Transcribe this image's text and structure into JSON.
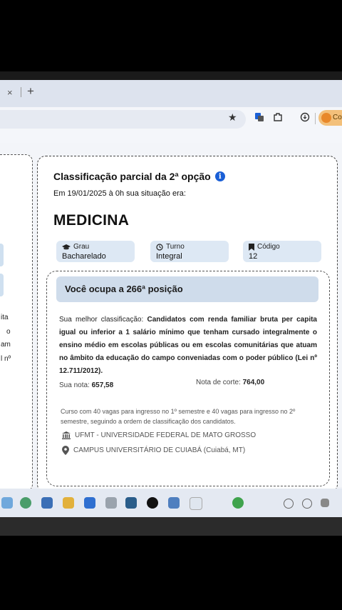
{
  "browser": {
    "tab_close_glyph": "×",
    "new_tab_glyph": "+",
    "profile_label": "Co"
  },
  "left_card": {
    "lines": [
      "ita",
      "o",
      "am",
      "l nº"
    ]
  },
  "result": {
    "title": "Classificação parcial da 2ª opção",
    "date_line": "Em 19/01/2025 à 0h sua situação era:",
    "course": "MEDICINA",
    "grau_label": "Grau",
    "grau_value": "Bacharelado",
    "turno_label": "Turno",
    "turno_value": "Integral",
    "codigo_label": "Código",
    "codigo_value": "12",
    "position_text": "Você ocupa a 266ª posição",
    "best_label": "Sua melhor classificação:",
    "best_text": "Candidatos com renda familiar bruta per capita igual ou inferior a 1 salário mínimo que tenham cursado integralmente o ensino médio em escolas públicas ou em escolas comunitárias que atuam no âmbito da educação do campo conveniadas com o poder público (Lei nº 12.711/2012).",
    "grade_label": "Sua nota:",
    "grade_value": "657,58",
    "cut_label": "Nota de corte:",
    "cut_value": "764,00",
    "vagas_text": "Curso com 40 vagas para ingresso no 1º semestre e 40 vagas para ingresso no 2º semestre, seguindo a ordem de classificação dos candidatos.",
    "university": "UFMT - UNIVERSIDADE FEDERAL DE MATO GROSSO",
    "campus": "CAMPUS UNIVERSITÁRIO DE CUIABÁ (Cuiabá, MT)"
  },
  "colors": {
    "accent_blue": "#1a5fd6",
    "pill_bg": "#dde8f4",
    "position_bg": "#cfdceb"
  }
}
